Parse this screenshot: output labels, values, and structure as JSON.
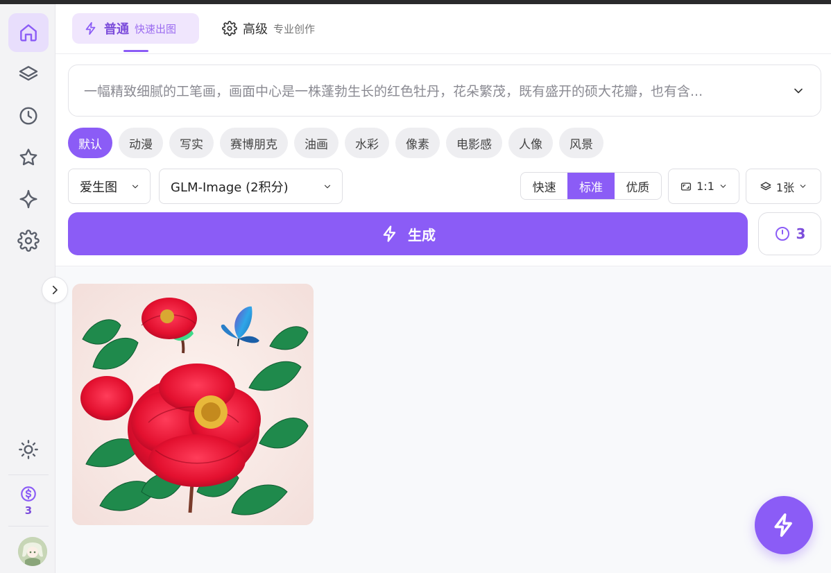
{
  "sidebar": {
    "items": [
      {
        "name": "home",
        "icon": "home-icon",
        "active": true
      },
      {
        "name": "layers",
        "icon": "layers-icon",
        "active": false
      },
      {
        "name": "history",
        "icon": "clock-icon",
        "active": false
      },
      {
        "name": "favorites",
        "icon": "star-icon",
        "active": false
      },
      {
        "name": "sparkle",
        "icon": "sparkle-icon",
        "active": false
      },
      {
        "name": "settings",
        "icon": "gear-icon",
        "active": false
      }
    ],
    "theme_icon": "sun-icon",
    "credits_icon": "coin-icon",
    "credits_value": "3",
    "avatar_icon": "avatar"
  },
  "header": {
    "tabs": [
      {
        "title": "普通",
        "subtitle": "快速出图",
        "icon": "lightning-icon",
        "active": true
      },
      {
        "title": "高级",
        "subtitle": "专业创作",
        "icon": "gear-icon",
        "active": false
      }
    ]
  },
  "prompt": {
    "text": "一幅精致细腻的工笔画，画面中心是一株蓬勃生长的红色牡丹，花朵繁茂，既有盛开的硕大花瓣，也有含..."
  },
  "styles": {
    "chips": [
      "默认",
      "动漫",
      "写实",
      "赛博朋克",
      "油画",
      "水彩",
      "像素",
      "电影感",
      "人像",
      "风景"
    ],
    "active_index": 0
  },
  "controls": {
    "app_select": "爱生图",
    "model_select": "GLM-Image (2积分)",
    "quality_options": [
      "快速",
      "标准",
      "优质"
    ],
    "quality_active_index": 1,
    "aspect_ratio": "1:1",
    "image_count": "1张"
  },
  "generate": {
    "label": "生成",
    "history_count": "3"
  },
  "colors": {
    "accent": "#8b5cf6",
    "accent_light": "#f0e6fd",
    "chip_bg": "#eeeef1"
  }
}
